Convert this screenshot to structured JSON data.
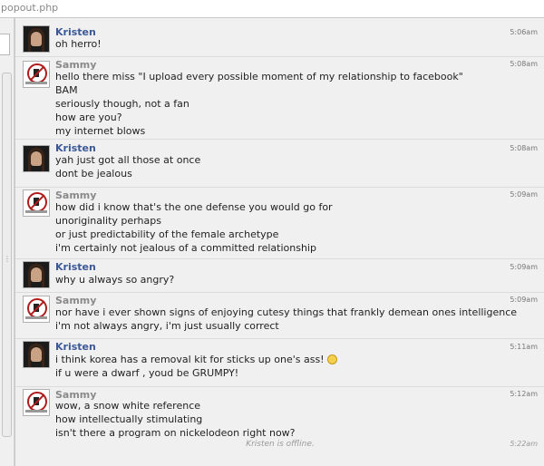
{
  "window": {
    "url": "popout.php"
  },
  "messages": [
    {
      "sender": "Kristen",
      "time": "5:06am",
      "lines": [
        "oh herro!"
      ]
    },
    {
      "sender": "Sammy",
      "time": "5:08am",
      "lines": [
        "hello there miss \"I upload every possible moment of my relationship to facebook\"",
        "BAM",
        "seriously though, not a fan",
        "how are you?",
        "my internet blows"
      ]
    },
    {
      "sender": "Kristen",
      "time": "5:08am",
      "lines": [
        "yah just got all those at once",
        "dont be jealous"
      ]
    },
    {
      "sender": "Sammy",
      "time": "5:09am",
      "lines": [
        "how did i know that's the one defense you would go for",
        "unoriginality perhaps",
        "or just predictability of the female archetype",
        "i'm certainly not jealous of a committed relationship"
      ]
    },
    {
      "sender": "Kristen",
      "time": "5:09am",
      "lines": [
        "why u always so angry?"
      ]
    },
    {
      "sender": "Sammy",
      "time": "5:09am",
      "lines": [
        "nor have i ever shown signs of enjoying cutesy things that frankly demean ones intelligence",
        "i'm not always angry, i'm just usually correct"
      ]
    },
    {
      "sender": "Kristen",
      "time": "5:11am",
      "lines": [
        "i think korea has a removal kit for sticks up one's ass!",
        "if u were a dwarf , youd be GRUMPY!"
      ]
    },
    {
      "sender": "Sammy",
      "time": "5:12am",
      "lines": [
        "wow, a snow white reference",
        "how intellectually stimulating",
        "isn't there a program on nickelodeon right now?"
      ]
    }
  ],
  "status": {
    "text": "Kristen is offline.",
    "time": "5:22am"
  },
  "colors": {
    "kristen_name": "#3b5998",
    "sammy_name": "#8a8a8a",
    "background": "#f0f0f0"
  }
}
